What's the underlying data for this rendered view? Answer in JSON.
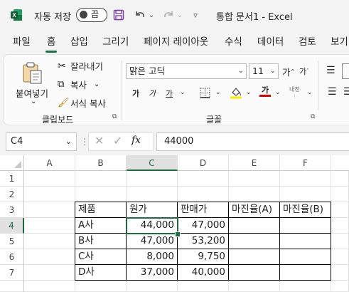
{
  "titlebar": {
    "autosave_label": "자동 저장",
    "autosave_state": "끔",
    "document_title": "통합 문서1  -  Excel"
  },
  "tabs": [
    "파일",
    "홈",
    "삽입",
    "그리기",
    "페이지 레이아웃",
    "수식",
    "데이터",
    "검토",
    "보기"
  ],
  "active_tab": "홈",
  "ribbon": {
    "clipboard": {
      "paste_label": "붙여넣기",
      "cut_label": "잘라내기",
      "copy_label": "복사",
      "format_painter_label": "서식 복사",
      "group_label": "클립보드"
    },
    "font": {
      "font_name": "맑은 고딕",
      "font_size": "11",
      "grow_label": "가",
      "shrink_label": "가",
      "bold_label": "가",
      "italic_label": "가",
      "underline_label": "가",
      "font_color_label": "가",
      "phonetic_label": "내천",
      "group_label": "글꼴"
    },
    "accent_color": "#1e7145"
  },
  "formula_bar": {
    "name_box": "C4",
    "fx_label": "fx",
    "formula": "44000"
  },
  "sheet": {
    "columns": [
      "A",
      "B",
      "C",
      "D",
      "E",
      "F"
    ],
    "selected_column": "C",
    "rows": [
      "1",
      "2",
      "3",
      "4",
      "5",
      "6",
      "7"
    ],
    "selected_row": "4",
    "table_header": [
      "제품",
      "원가",
      "판매가",
      "마진율(A)",
      "마진율(B)"
    ],
    "table_rows": [
      [
        "A사",
        "44,000",
        "47,000",
        "",
        ""
      ],
      [
        "B사",
        "47,000",
        "53,200",
        "",
        ""
      ],
      [
        "C사",
        "8,000",
        "9,750",
        "",
        ""
      ],
      [
        "D사",
        "37,000",
        "40,000",
        "",
        ""
      ]
    ],
    "active_cell": "C4"
  }
}
